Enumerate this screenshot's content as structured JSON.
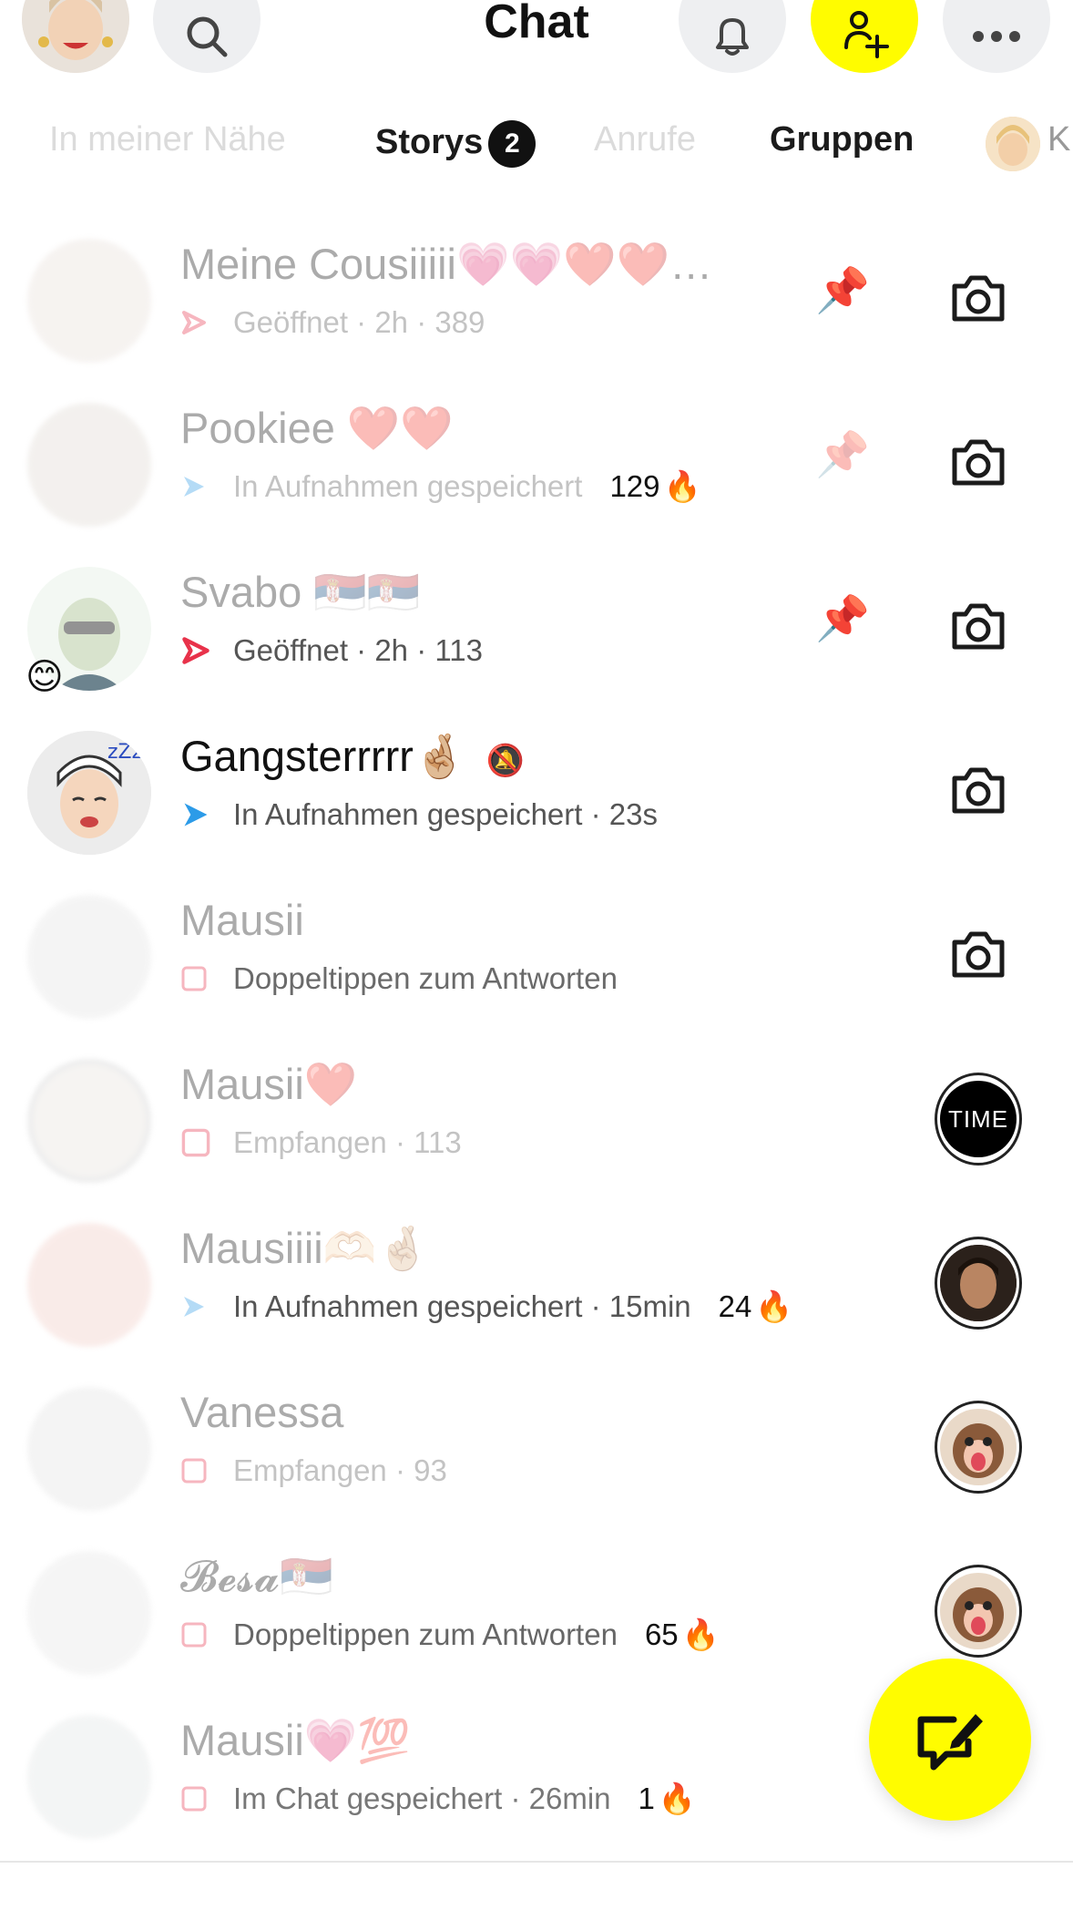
{
  "header": {
    "title": "Chat",
    "accent": "#fffc00"
  },
  "tabs": [
    {
      "label": "In meiner Nähe"
    },
    {
      "label": "Storys",
      "badge": "2"
    },
    {
      "label": "Anrufe"
    },
    {
      "label": "Gruppen"
    },
    {
      "label": "K"
    }
  ],
  "chats": [
    {
      "name": "Meine Cousiiiii💗💗❤️❤️…",
      "sub": "Geöffnet · 2h · 389",
      "pinned": true,
      "right": "camera-icon"
    },
    {
      "name": "Pookiee ❤️❤️",
      "sub": "In Aufnahmen gespeichert",
      "streak": "129",
      "pinned": true,
      "right": "camera-icon"
    },
    {
      "name": "Svabo 🇷🇸🇷🇸",
      "sub": "Geöffnet · 2h · 113",
      "pinned": true,
      "right": "camera-icon"
    },
    {
      "name": "Gangsterrrrr🤞🏼",
      "sub": "In Aufnahmen gespeichert · 23s",
      "right": "camera-icon"
    },
    {
      "name": "Mausii",
      "sub": "Doppeltippen zum Antworten",
      "right": "camera-icon"
    },
    {
      "name": "Mausii❤️",
      "sub": "Empfangen · 113",
      "right": "story-time"
    },
    {
      "name": "Mausiiii🫶🏻🤞🏼",
      "sub": "In Aufnahmen gespeichert · 15min",
      "streak": "24",
      "right": "story-man"
    },
    {
      "name": "Vanessa",
      "sub": "Empfangen · 93",
      "right": "story-funny"
    },
    {
      "name": "𝓑𝓮𝓼𝓪🇷🇸",
      "sub": "Doppeltippen zum Antworten",
      "streak": "65",
      "right": "story-funny"
    },
    {
      "name": "Mausii💗💯",
      "sub": "Im Chat gespeichert · 26min",
      "streak": "1",
      "right": "none"
    }
  ],
  "story_time_label": "TIME",
  "fab": {
    "icon": "new-chat-icon"
  }
}
